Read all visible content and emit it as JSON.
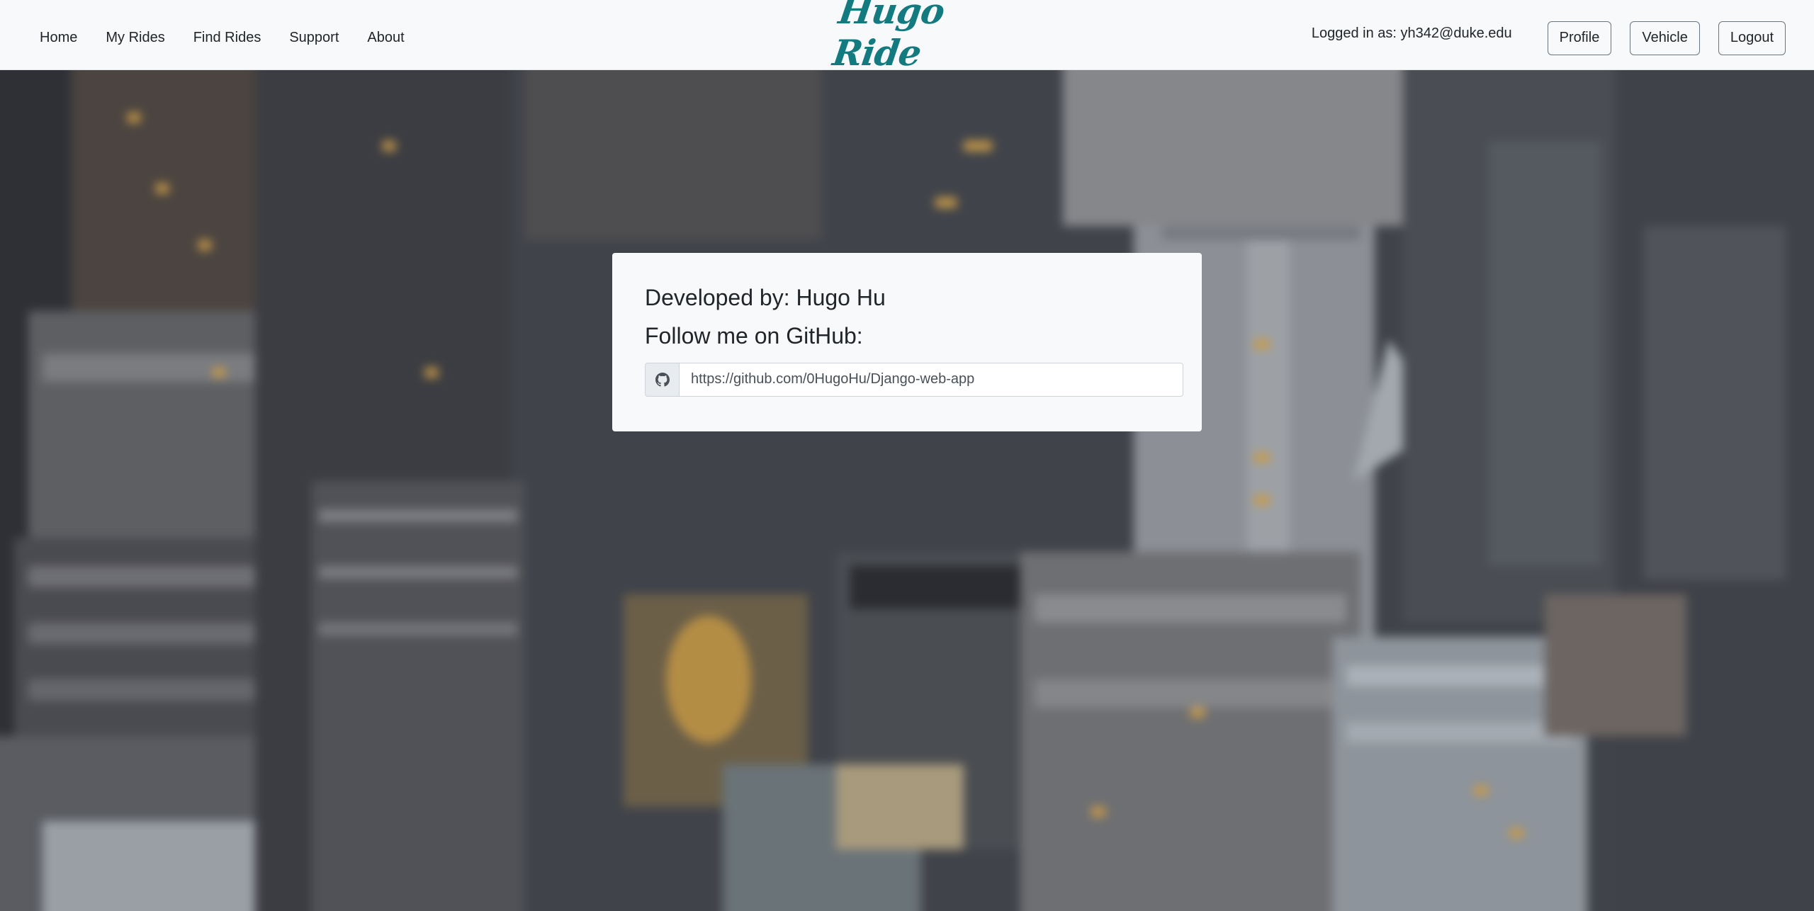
{
  "nav": {
    "links": [
      {
        "label": "Home"
      },
      {
        "label": "My Rides"
      },
      {
        "label": "Find Rides"
      },
      {
        "label": "Support"
      },
      {
        "label": "About"
      }
    ],
    "brand": "Hugo Ride",
    "login_text": "Logged in as: yh342@duke.edu",
    "buttons": {
      "profile": "Profile",
      "vehicle": "Vehicle",
      "logout": "Logout"
    }
  },
  "card": {
    "developer": "Developed by: Hugo Hu",
    "follow": "Follow me on GitHub:",
    "github_icon": "github-icon",
    "github_url": "https://github.com/0HugoHu/Django-web-app"
  },
  "colors": {
    "brand": "#137a80",
    "navbar_bg": "#f8f9fa",
    "card_bg": "#f8f9fa"
  }
}
